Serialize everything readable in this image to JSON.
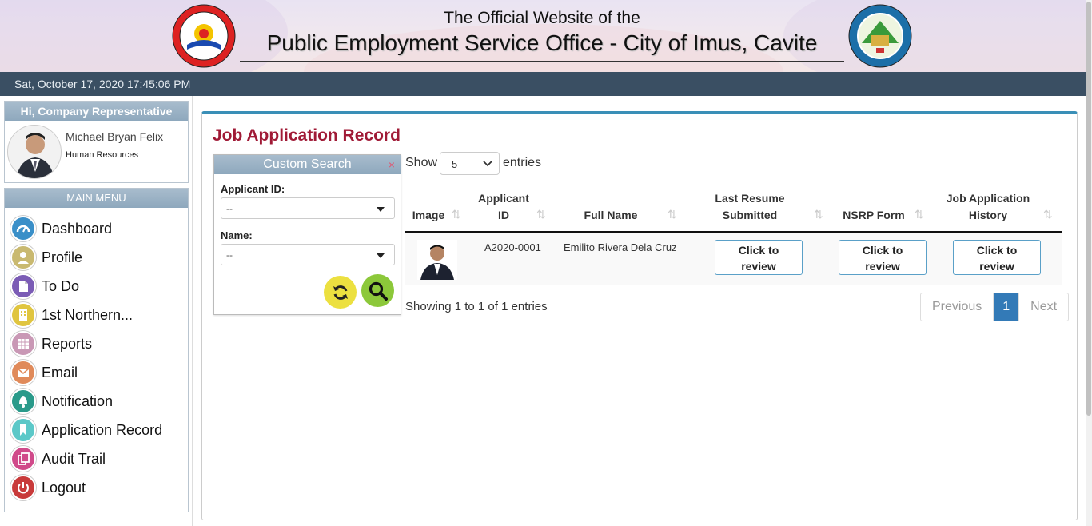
{
  "header": {
    "line1": "The Official Website of the",
    "line2": "Public Employment Service Office - City of Imus, Cavite",
    "left_logo_text": "PUBLIC EMPLOYMENT SERVICE OFFICE",
    "left_logo_abbr": "P.E.S.O.",
    "right_logo_text": "LUNGSOD NG IMUS",
    "right_logo_bottom": "LALAWIGAN NG CAVITE",
    "right_logo_year": "2012"
  },
  "datebar": {
    "text": "Sat, October 17, 2020 17:45:06 PM"
  },
  "user_panel": {
    "greeting": "Hi, Company Representative",
    "name": "Michael Bryan Felix",
    "role": "Human Resources"
  },
  "menu": {
    "title": "MAIN MENU",
    "items": [
      {
        "label": "Dashboard",
        "icon": "dashboard-icon",
        "color": "#3a8fc8"
      },
      {
        "label": "Profile",
        "icon": "user-icon",
        "color": "#c9b970"
      },
      {
        "label": "To Do",
        "icon": "document-icon",
        "color": "#7b5cb5"
      },
      {
        "label": "1st Northern...",
        "icon": "building-icon",
        "color": "#e0c540"
      },
      {
        "label": "Reports",
        "icon": "table-icon",
        "color": "#c998b5"
      },
      {
        "label": "Email",
        "icon": "mail-icon",
        "color": "#e08a5a"
      },
      {
        "label": "Notification",
        "icon": "bell-icon",
        "color": "#2a9a8a"
      },
      {
        "label": "Application Record",
        "icon": "bookmark-icon",
        "color": "#5cc8c8"
      },
      {
        "label": "Audit Trail",
        "icon": "copy-icon",
        "color": "#d04a8a"
      },
      {
        "label": "Logout",
        "icon": "power-icon",
        "color": "#c83a3a"
      }
    ]
  },
  "page": {
    "title": "Job Application Record"
  },
  "search": {
    "title": "Custom Search",
    "close": "×",
    "applicant_id_label": "Applicant ID:",
    "applicant_id_value": "--",
    "name_label": "Name:",
    "name_value": "--",
    "reset_color": "#ece040",
    "search_color": "#8cc83a"
  },
  "table": {
    "show_label": "Show",
    "entries_value": "5",
    "entries_label": "entries",
    "headers": {
      "image": "Image",
      "applicant_id_1": "Applicant",
      "applicant_id_2": "ID",
      "full_name": "Full Name",
      "resume_1": "Last Resume",
      "resume_2": "Submitted",
      "nsrp": "NSRP Form",
      "history_1": "Job Application",
      "history_2": "History"
    },
    "rows": [
      {
        "applicant_id": "A2020-0001",
        "full_name": "Emilito Rivera Dela Cruz",
        "resume_btn_1": "Click to",
        "resume_btn_2": "review",
        "nsrp_btn_1": "Click to",
        "nsrp_btn_2": "review",
        "history_btn_1": "Click to",
        "history_btn_2": "review"
      }
    ],
    "showing": "Showing 1 to 1 of 1 entries",
    "pagination": {
      "previous": "Previous",
      "page": "1",
      "next": "Next"
    }
  },
  "colors": {
    "accent": "#a01a36",
    "datebar": "#3a4f63",
    "card_border": "#3a8fb7",
    "pager_active": "#337ab7"
  }
}
